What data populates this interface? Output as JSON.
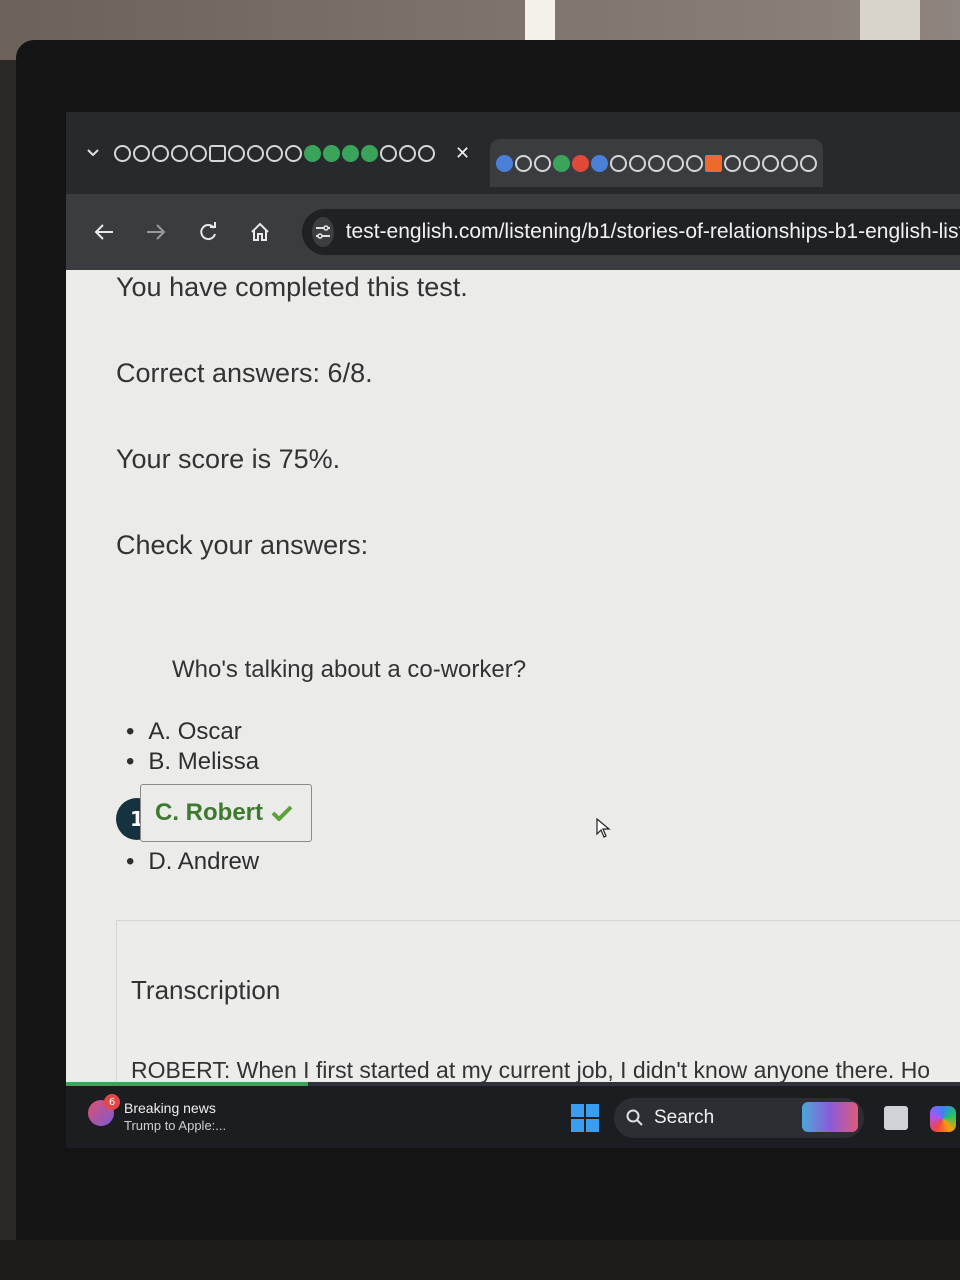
{
  "browser": {
    "url": "test-english.com/listening/b1/stories-of-relationships-b1-english-liste"
  },
  "results": {
    "completed": "You have completed this test.",
    "correct_answers": "Correct answers: 6/8.",
    "score": "Your score is 75%.",
    "check_answers": "Check your answers:"
  },
  "question": {
    "number": "1",
    "text": "Who's talking about a co-worker?",
    "options": [
      "A. Oscar",
      "B. Melissa",
      "C. Robert",
      "D. Andrew"
    ],
    "correct_option": "C. Robert"
  },
  "transcription": {
    "heading": "Transcription",
    "first_line": "ROBERT: When I first started at my current job, I didn't know anyone there. Ho"
  },
  "taskbar": {
    "news_badge": "6",
    "news_title": "Breaking news",
    "news_subtitle": "Trump to Apple:...",
    "search_label": "Search"
  }
}
